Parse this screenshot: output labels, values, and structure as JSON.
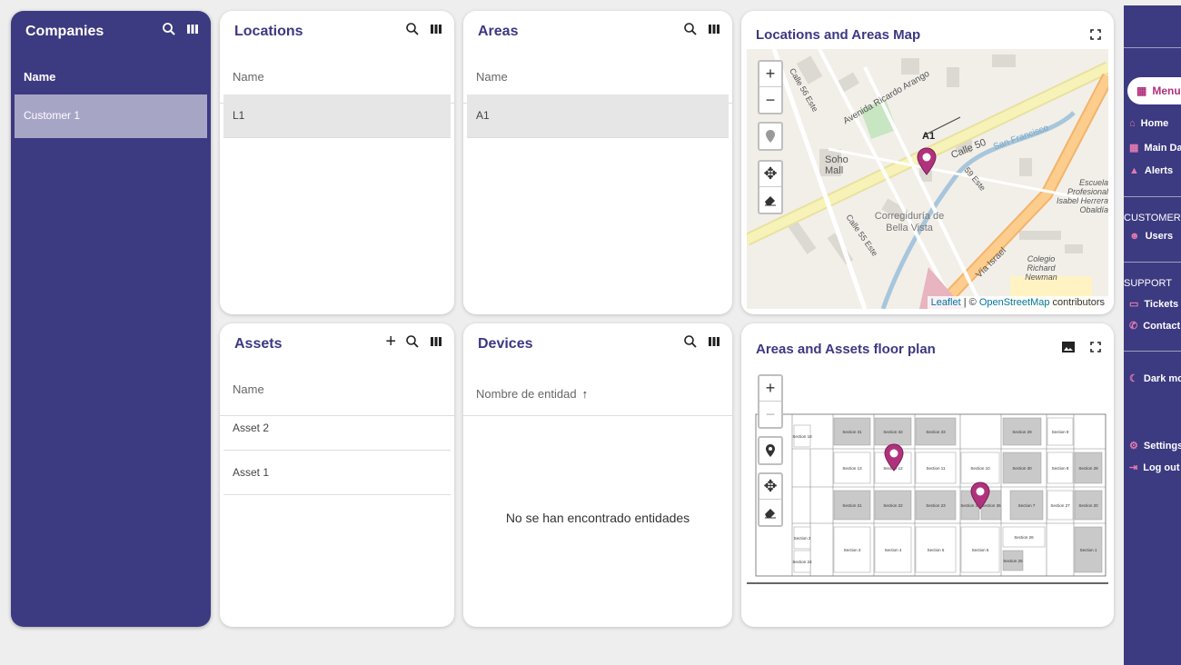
{
  "companies": {
    "title": "Companies",
    "col": "Name",
    "rows": [
      "Customer 1"
    ]
  },
  "locations": {
    "title": "Locations",
    "col": "Name",
    "rows": [
      "L1"
    ]
  },
  "areas": {
    "title": "Areas",
    "col": "Name",
    "rows": [
      "A1"
    ]
  },
  "map": {
    "title": "Locations and Areas Map",
    "labels": [
      "Calle 50",
      "Avenida Ricardo Arango",
      "San Francisco",
      "Soho Mall",
      "Calle 56 Este",
      "Calle 55 Este",
      "59 Este",
      "Corregiduría de Bella Vista",
      "Vía Israel",
      "Colegio Richard Newman",
      "Escuela Profesional Isabel Herrera Obaldía",
      "A1"
    ],
    "attrib_leaflet": "Leaflet",
    "attrib_sep": " | © ",
    "attrib_osm": "OpenStreetMap",
    "attrib_tail": " contributors"
  },
  "assets": {
    "title": "Assets",
    "col": "Name",
    "rows": [
      "Asset 2",
      "Asset 1"
    ]
  },
  "devices": {
    "title": "Devices",
    "col": "Nombre de entidad",
    "empty": "No se han encontrado entidades"
  },
  "floor": {
    "title": "Areas and Assets floor plan",
    "sections": [
      "Section 31",
      "Section 32",
      "Section 33",
      "Section 29",
      "Section 9",
      "Section 18",
      "Section 13",
      "Section 12",
      "Section 11",
      "Section 10",
      "Section 30",
      "Section 8",
      "Section 28",
      "Section 21",
      "Section 22",
      "Section 23",
      "Section 35",
      "Section 36",
      "Section 7",
      "Section 27",
      "Section 20",
      "Section 2",
      "Section 3",
      "Section 4",
      "Section 5",
      "Section 6",
      "Section 26",
      "Section 1",
      "Section 24",
      "Section 25"
    ]
  },
  "sidebar": {
    "menu": "Menu",
    "items": [
      "Home",
      "Main Dashboard",
      "Alerts"
    ],
    "customer": "CUSTOMER",
    "users": "Users",
    "support": "SUPPORT",
    "tickets": "Tickets",
    "contact": "Contact",
    "dark": "Dark mode",
    "settings": "Settings",
    "logout": "Log out"
  },
  "colors": {
    "primary": "#3c3a80",
    "accent": "#b0327c",
    "selected": "#a7a5c6"
  }
}
